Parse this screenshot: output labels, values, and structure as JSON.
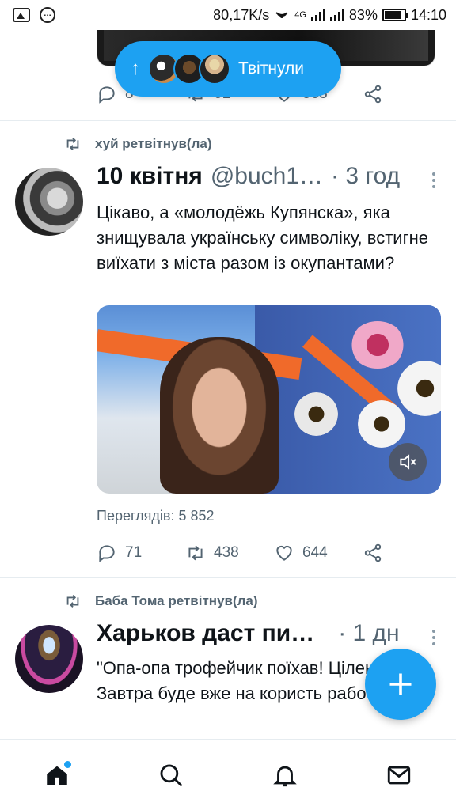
{
  "status_bar": {
    "network_speed": "80,17K/s",
    "network_type": "4G",
    "battery_percent": "83%",
    "time": "14:10"
  },
  "new_tweets_pill": {
    "label": "Твітнули",
    "arrow": "↑"
  },
  "previous_tweet": {
    "replies": "8",
    "retweets": "61",
    "likes": "568"
  },
  "tweets": [
    {
      "retweeted_by": "хуй ретвітнув(ла)",
      "name": "10 квітня",
      "handle": "@buch1…",
      "time": "· 3 год",
      "text": "Цікаво, а  «молодёжь Купянска», яка знищувала українську символіку, встигне виїхати з міста разом із окупантами?",
      "views": "Переглядів: 5 852",
      "replies": "71",
      "retweets": "438",
      "likes": "644"
    },
    {
      "retweeted_by": "Баба Тома ретвітнув(ла)",
      "name": "Харьков даст пи…",
      "time": "· 1 дн",
      "text": "\"Опа-опа трофейчик поїхав! Ціленький! Завтра буде вже на користь работать.\""
    }
  ],
  "colors": {
    "accent": "#1da1f2",
    "secondary_text": "#536471"
  }
}
